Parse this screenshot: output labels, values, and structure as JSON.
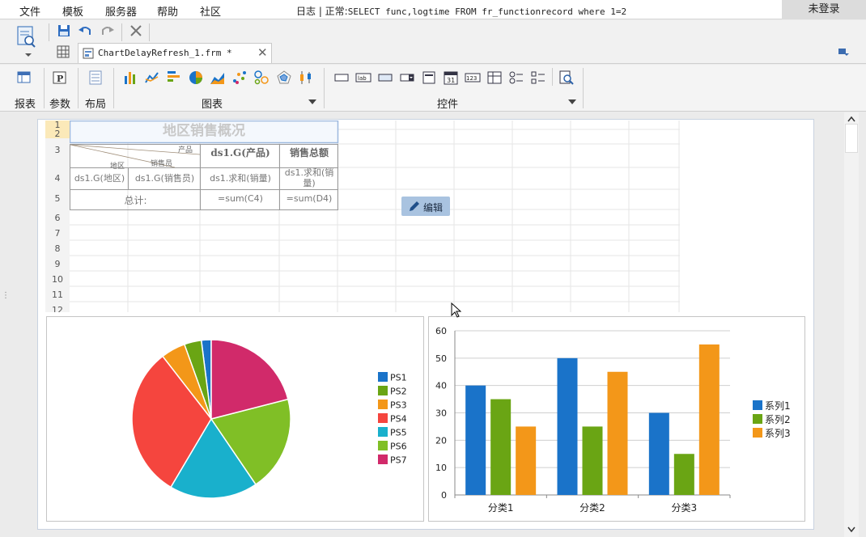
{
  "menu": {
    "items": [
      "文件",
      "模板",
      "服务器",
      "帮助",
      "社区"
    ],
    "status_prefix": "日志 | 正常:",
    "status_sql": "SELECT func,logtime FROM fr_functionrecord where 1=2",
    "login": "未登录"
  },
  "tab": {
    "label": "ChartDelayRefresh_1.frm *"
  },
  "ribbon": {
    "report": "报表",
    "param": "参数",
    "layout": "布局",
    "chart": "图表",
    "widget": "控件",
    "widget_icon_labels": [
      "lab",
      "31",
      "123"
    ]
  },
  "sheet": {
    "row_numbers": [
      "1",
      "2",
      "3",
      "4",
      "5",
      "6",
      "7",
      "8",
      "9",
      "10",
      "11",
      "12"
    ],
    "title": "地区销售概况",
    "slash_header": {
      "top": "产品",
      "middle": "销售员",
      "bottom": "地区"
    },
    "header_product": "ds1.G(产品)",
    "header_total": "销售总额",
    "cell_region": "ds1.G(地区)",
    "cell_salesman": "ds1.G(销售员)",
    "cell_sum_qty": "ds1.求和(销量)",
    "cell_sum_sales": "ds1.求和(销\n量)",
    "total_label": "总计:",
    "sum_c4": "=sum(C4)",
    "sum_d4": "=sum(D4)"
  },
  "edit_button": {
    "label": "编辑"
  },
  "colors": {
    "accent_blue": "#1a73c9",
    "green": "#6aa514",
    "orange": "#f39719",
    "red": "#f5453e",
    "cyan": "#19b0cc",
    "lime": "#80bf26",
    "magenta": "#d12a6a"
  },
  "chart_data": [
    {
      "type": "pie",
      "categories": [
        "PS1",
        "PS2",
        "PS3",
        "PS4",
        "PS5",
        "PS6",
        "PS7"
      ],
      "values": [
        2,
        3.5,
        5,
        31,
        18,
        19.5,
        21
      ],
      "legend": "right",
      "colors": [
        "#1a73c9",
        "#6aa514",
        "#f39719",
        "#f5453e",
        "#19b0cc",
        "#80bf26",
        "#d12a6a"
      ]
    },
    {
      "type": "bar",
      "categories": [
        "分类1",
        "分类2",
        "分类3"
      ],
      "series": [
        {
          "name": "系列1",
          "values": [
            40,
            50,
            30
          ],
          "color": "#1a73c9"
        },
        {
          "name": "系列2",
          "values": [
            35,
            25,
            15
          ],
          "color": "#6aa514"
        },
        {
          "name": "系列3",
          "values": [
            25,
            45,
            55
          ],
          "color": "#f39719"
        }
      ],
      "ylim": [
        0,
        60
      ],
      "yticks": [
        0,
        10,
        20,
        30,
        40,
        50,
        60
      ],
      "grid": true,
      "legend": "right"
    }
  ]
}
